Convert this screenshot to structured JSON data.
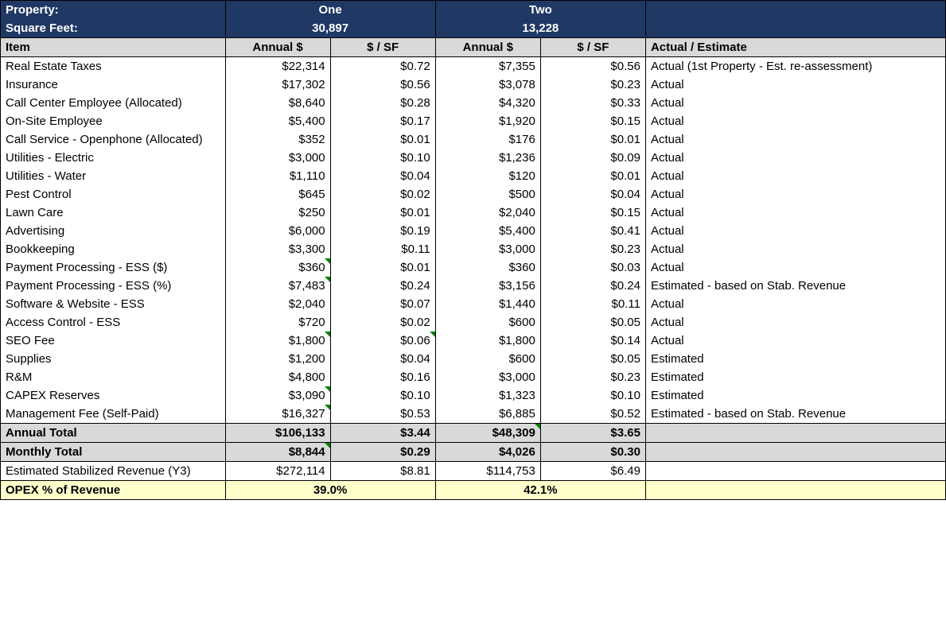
{
  "labels": {
    "property": "Property:",
    "sqft": "Square Feet:",
    "item": "Item",
    "annual": "Annual $",
    "psf": "$ / SF",
    "notes": "Actual / Estimate",
    "annual_total": "Annual Total",
    "monthly_total": "Monthly Total",
    "stab_rev": "Estimated Stabilized Revenue (Y3)",
    "opex_pct": "OPEX % of Revenue"
  },
  "properties": [
    {
      "name": "One",
      "sqft": "30,897"
    },
    {
      "name": "Two",
      "sqft": "13,228"
    }
  ],
  "rows": [
    {
      "item": "Real Estate Taxes",
      "p1a": "$22,314",
      "p1s": "$0.72",
      "p2a": "$7,355",
      "p2s": "$0.56",
      "note": "Actual (1st Property - Est. re-assessment)"
    },
    {
      "item": "Insurance",
      "p1a": "$17,302",
      "p1s": "$0.56",
      "p2a": "$3,078",
      "p2s": "$0.23",
      "note": "Actual"
    },
    {
      "item": "Call Center Employee (Allocated)",
      "p1a": "$8,640",
      "p1s": "$0.28",
      "p2a": "$4,320",
      "p2s": "$0.33",
      "note": "Actual"
    },
    {
      "item": "On-Site Employee",
      "p1a": "$5,400",
      "p1s": "$0.17",
      "p2a": "$1,920",
      "p2s": "$0.15",
      "note": "Actual"
    },
    {
      "item": "Call Service - Openphone (Allocated)",
      "p1a": "$352",
      "p1s": "$0.01",
      "p2a": "$176",
      "p2s": "$0.01",
      "note": "Actual"
    },
    {
      "item": "Utilities - Electric",
      "p1a": "$3,000",
      "p1s": "$0.10",
      "p2a": "$1,236",
      "p2s": "$0.09",
      "note": "Actual"
    },
    {
      "item": "Utilities - Water",
      "p1a": "$1,110",
      "p1s": "$0.04",
      "p2a": "$120",
      "p2s": "$0.01",
      "note": "Actual"
    },
    {
      "item": "Pest Control",
      "p1a": "$645",
      "p1s": "$0.02",
      "p2a": "$500",
      "p2s": "$0.04",
      "note": "Actual"
    },
    {
      "item": "Lawn Care",
      "p1a": "$250",
      "p1s": "$0.01",
      "p2a": "$2,040",
      "p2s": "$0.15",
      "note": "Actual"
    },
    {
      "item": "Advertising",
      "p1a": "$6,000",
      "p1s": "$0.19",
      "p2a": "$5,400",
      "p2s": "$0.41",
      "note": "Actual"
    },
    {
      "item": "Bookkeeping",
      "p1a": "$3,300",
      "p1s": "$0.11",
      "p2a": "$3,000",
      "p2s": "$0.23",
      "note": "Actual"
    },
    {
      "item": "Payment Processing - ESS ($)",
      "p1a": "$360",
      "p1s": "$0.01",
      "p2a": "$360",
      "p2s": "$0.03",
      "note": "Actual",
      "flag_p1a": true
    },
    {
      "item": "Payment Processing - ESS (%)",
      "p1a": "$7,483",
      "p1s": "$0.24",
      "p2a": "$3,156",
      "p2s": "$0.24",
      "note": "Estimated - based on Stab. Revenue",
      "flag_p1a": true
    },
    {
      "item": "Software & Website - ESS",
      "p1a": "$2,040",
      "p1s": "$0.07",
      "p2a": "$1,440",
      "p2s": "$0.11",
      "note": "Actual"
    },
    {
      "item": "Access Control - ESS",
      "p1a": "$720",
      "p1s": "$0.02",
      "p2a": "$600",
      "p2s": "$0.05",
      "note": "Actual"
    },
    {
      "item": "SEO Fee",
      "p1a": "$1,800",
      "p1s": "$0.06",
      "p2a": "$1,800",
      "p2s": "$0.14",
      "note": "Actual",
      "flag_p1a": true,
      "flag_p1s": true
    },
    {
      "item": "Supplies",
      "p1a": "$1,200",
      "p1s": "$0.04",
      "p2a": "$600",
      "p2s": "$0.05",
      "note": "Estimated"
    },
    {
      "item": "R&M",
      "p1a": "$4,800",
      "p1s": "$0.16",
      "p2a": "$3,000",
      "p2s": "$0.23",
      "note": "Estimated"
    },
    {
      "item": "CAPEX Reserves",
      "p1a": "$3,090",
      "p1s": "$0.10",
      "p2a": "$1,323",
      "p2s": "$0.10",
      "note": "Estimated",
      "flag_p1a": true
    },
    {
      "item": "Management Fee (Self-Paid)",
      "p1a": "$16,327",
      "p1s": "$0.53",
      "p2a": "$6,885",
      "p2s": "$0.52",
      "note": "Estimated - based on Stab. Revenue",
      "flag_p1a": true
    }
  ],
  "annual_total": {
    "p1a": "$106,133",
    "p1s": "$3.44",
    "p2a": "$48,309",
    "p2s": "$3.65",
    "flag_p2a": true
  },
  "monthly_total": {
    "p1a": "$8,844",
    "p1s": "$0.29",
    "p2a": "$4,026",
    "p2s": "$0.30",
    "flag_p1a": true
  },
  "stab_rev": {
    "p1a": "$272,114",
    "p1s": "$8.81",
    "p2a": "$114,753",
    "p2s": "$6.49"
  },
  "opex_pct": {
    "p1": "39.0%",
    "p2": "42.1%"
  }
}
